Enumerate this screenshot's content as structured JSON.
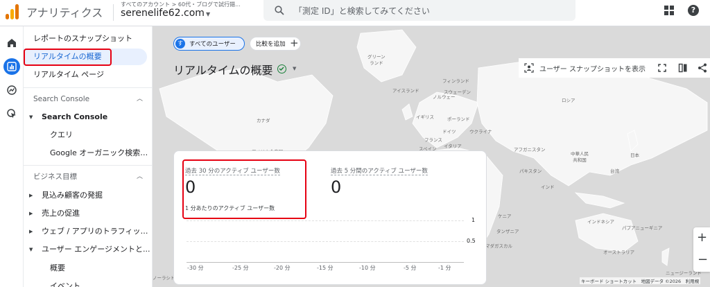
{
  "header": {
    "app_title": "アナリティクス",
    "breadcrumb": "すべてのアカウント > 60代・ブログで試行錯...",
    "property": "serenelife62.com",
    "search_placeholder": "「測定 ID」と検索してみてください"
  },
  "nav": {
    "items": [
      {
        "label": "レポートのスナップショット"
      },
      {
        "label": "リアルタイムの概要"
      },
      {
        "label": "リアルタイム ページ"
      },
      {
        "label": "Search Console"
      },
      {
        "label": "Search Console"
      },
      {
        "label": "クエリ"
      },
      {
        "label": "Google オーガニック検索レ..."
      },
      {
        "label": "ビジネス目標"
      },
      {
        "label": "見込み顧客の発掘"
      },
      {
        "label": "売上の促進"
      },
      {
        "label": "ウェブ / アプリのトラフィック..."
      },
      {
        "label": "ユーザー エンゲージメントと..."
      },
      {
        "label": "概要"
      },
      {
        "label": "イベント"
      }
    ]
  },
  "filters": {
    "avatar_letter": "す",
    "segment_label": "すべてのユーザー",
    "add_comparison_label": "比較を追加"
  },
  "page": {
    "title": "リアルタイムの概要",
    "snapshot_label": "ユーザー スナップショットを表示"
  },
  "map": {
    "labels": [
      {
        "text": "グリーン\nランド"
      },
      {
        "text": "アイスランド"
      },
      {
        "text": "フィンランド"
      },
      {
        "text": "スウェーデン"
      },
      {
        "text": "ノルウェー"
      },
      {
        "text": "ロシア"
      },
      {
        "text": "イギリス"
      },
      {
        "text": "ポーランド"
      },
      {
        "text": "ドイツ"
      },
      {
        "text": "ウクライナ"
      },
      {
        "text": "フランス"
      },
      {
        "text": "スペイン"
      },
      {
        "text": "イタリア"
      },
      {
        "text": "カナダ"
      },
      {
        "text": "アメリカ合衆国"
      },
      {
        "text": "アフガニスタン"
      },
      {
        "text": "パキスタン"
      },
      {
        "text": "中華人民\n共和国"
      },
      {
        "text": "日本"
      },
      {
        "text": "インド"
      },
      {
        "text": "台湾"
      },
      {
        "text": "ケニア"
      },
      {
        "text": "タンザニア"
      },
      {
        "text": "インドネシア"
      },
      {
        "text": "パプアニューギニア"
      },
      {
        "text": "マダガスカル"
      },
      {
        "text": "オーストラリア"
      },
      {
        "text": "ニュージーランド"
      },
      {
        "text": "ノーラシド"
      }
    ],
    "attribution": "キーボード ショートカット　地図データ ©2026　利用規"
  },
  "card": {
    "metric1_label": "過去 30 分のアクティブ ユーザー数",
    "metric1_value": "0",
    "metric2_label": "過去 5 分間のアクティブ ユーザー数",
    "metric2_value": "0",
    "chart_subtitle": "1 分あたりのアクティブ ユーザー数"
  },
  "chart_data": {
    "type": "bar",
    "title": "1 分あたりのアクティブ ユーザー数",
    "categories": [
      "-30 分",
      "-25 分",
      "-20 分",
      "-15 分",
      "-10 分",
      "-5 分",
      "-1 分"
    ],
    "values": [
      0,
      0,
      0,
      0,
      0,
      0,
      0
    ],
    "yticks": [
      "1",
      "0.5"
    ],
    "ylim": [
      0,
      1
    ],
    "grid": true
  },
  "colors": {
    "accent": "#1a73e8",
    "highlight_box": "#e60012"
  }
}
